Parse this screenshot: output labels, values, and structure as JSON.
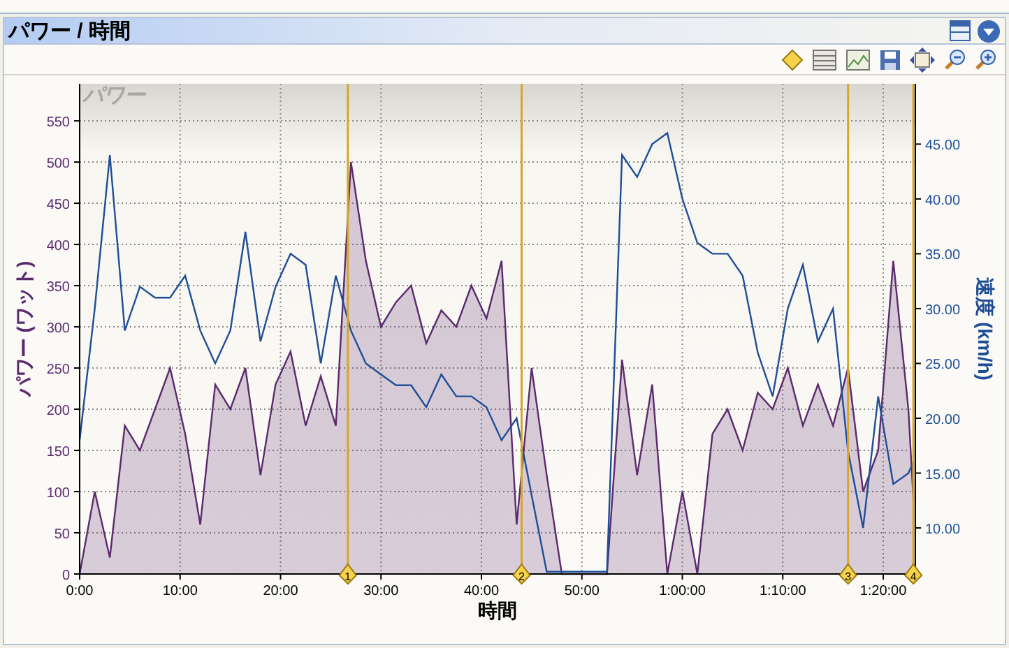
{
  "panel": {
    "title": "パワー / 時間"
  },
  "chart_data": {
    "type": "area",
    "title": "パワー",
    "xlabel": "時間",
    "ylabel": "パワー (ワット)",
    "y2label": "速度 (km/h)",
    "x": [
      0,
      1.5,
      3,
      4.5,
      6,
      7.5,
      9,
      10.5,
      12,
      13.5,
      15,
      16.5,
      18,
      19.5,
      21,
      22.5,
      24,
      25.5,
      27,
      28.5,
      30,
      31.5,
      33,
      34.5,
      36,
      37.5,
      39,
      40.5,
      42,
      43.5,
      45,
      46.5,
      48,
      49.5,
      51,
      52.5,
      54,
      55.5,
      57,
      58.5,
      60,
      61.5,
      63,
      64.5,
      66,
      67.5,
      69,
      70.5,
      72,
      73.5,
      75,
      76.5,
      78,
      79.5,
      81,
      82.5,
      83
    ],
    "series": [
      {
        "color": "#5b2a6e",
        "values": [
          0,
          100,
          20,
          180,
          150,
          200,
          250,
          170,
          60,
          230,
          200,
          250,
          120,
          230,
          270,
          180,
          240,
          180,
          500,
          380,
          300,
          330,
          350,
          280,
          320,
          300,
          350,
          310,
          380,
          60,
          250,
          120,
          0,
          0,
          0,
          0,
          260,
          120,
          230,
          0,
          100,
          0,
          170,
          200,
          150,
          220,
          200,
          250,
          180,
          230,
          180,
          250,
          100,
          150,
          380,
          200,
          90
        ]
      },
      {
        "type": "line",
        "color": "#1f4e96",
        "axis": "y2",
        "values": [
          18,
          30,
          44,
          28,
          32,
          31,
          31,
          33,
          28,
          25,
          28,
          37,
          27,
          32,
          35,
          34,
          25,
          33,
          28,
          25,
          24,
          23,
          23,
          21,
          24,
          22,
          22,
          21,
          18,
          20,
          13,
          6,
          6,
          6,
          6,
          6,
          44,
          42,
          45,
          46,
          40,
          36,
          35,
          35,
          33,
          26,
          22,
          30,
          34,
          27,
          30,
          17,
          10,
          22,
          14,
          15,
          16
        ]
      }
    ],
    "grid": true,
    "xlim": [
      0,
      83.2
    ],
    "ylim": [
      0,
      595
    ],
    "y2lim": [
      5.8,
      50.5
    ],
    "xticks": [
      {
        "value": 0,
        "label": "0:00"
      },
      {
        "value": 10,
        "label": "10:00"
      },
      {
        "value": 20,
        "label": "20:00"
      },
      {
        "value": 30,
        "label": "30:00"
      },
      {
        "value": 40,
        "label": "40:00"
      },
      {
        "value": 50,
        "label": "50:00"
      },
      {
        "value": 60,
        "label": "1:00:00"
      },
      {
        "value": 70,
        "label": "1:10:00"
      },
      {
        "value": 80,
        "label": "1:20:00"
      }
    ],
    "yticks": [
      0,
      50,
      100,
      150,
      200,
      250,
      300,
      350,
      400,
      450,
      500,
      550
    ],
    "y2ticks": [
      {
        "value": 10,
        "label": "10.00"
      },
      {
        "value": 15,
        "label": "15.00"
      },
      {
        "value": 20,
        "label": "20.00"
      },
      {
        "value": 25,
        "label": "25.00"
      },
      {
        "value": 30,
        "label": "30.00"
      },
      {
        "value": 35,
        "label": "35.00"
      },
      {
        "value": 40,
        "label": "40.00"
      },
      {
        "value": 45,
        "label": "45.00"
      }
    ],
    "annotations": [
      {
        "x": 26.7,
        "text": "1"
      },
      {
        "x": 44.0,
        "text": "2"
      },
      {
        "x": 76.5,
        "text": "3"
      },
      {
        "x": 83.0,
        "text": "4"
      }
    ]
  }
}
